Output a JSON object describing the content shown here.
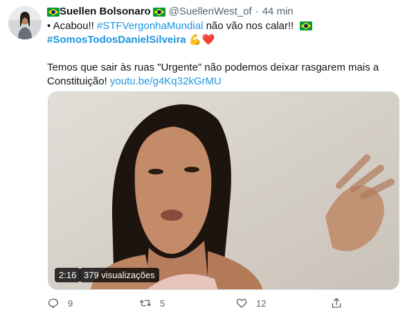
{
  "tweet": {
    "author_name": "Suellen Bolsonaro",
    "handle": "@SuellenWest_of",
    "separator": "·",
    "time": "44 min",
    "line1_prefix": "• Acabou!! ",
    "line1_hashtag": "#STFVergonhaMundial",
    "line1_suffix": " não vão nos calar!!",
    "line2_hashtag": "#SomosTodosDanielSilveira",
    "line2_emoji": "💪❤️",
    "body_line1": "Temos que sair às ruas \"Urgente\" não podemos deixar rasgarem mais a",
    "body_line2": "Constituição! ",
    "body_link": "youtu.be/g4Kq32kGrMU"
  },
  "video": {
    "duration": "2:16",
    "views": "379 visualizações"
  },
  "actions": {
    "reply_count": "9",
    "retweet_count": "5",
    "like_count": "12"
  },
  "colors": {
    "link": "#1b95e0",
    "muted": "#536471",
    "brazil_green": "#009b3a",
    "brazil_yellow": "#fedf00",
    "brazil_blue": "#002776"
  },
  "icons": [
    "brazil-flag-icon",
    "reply-icon",
    "retweet-icon",
    "like-icon",
    "share-icon"
  ]
}
